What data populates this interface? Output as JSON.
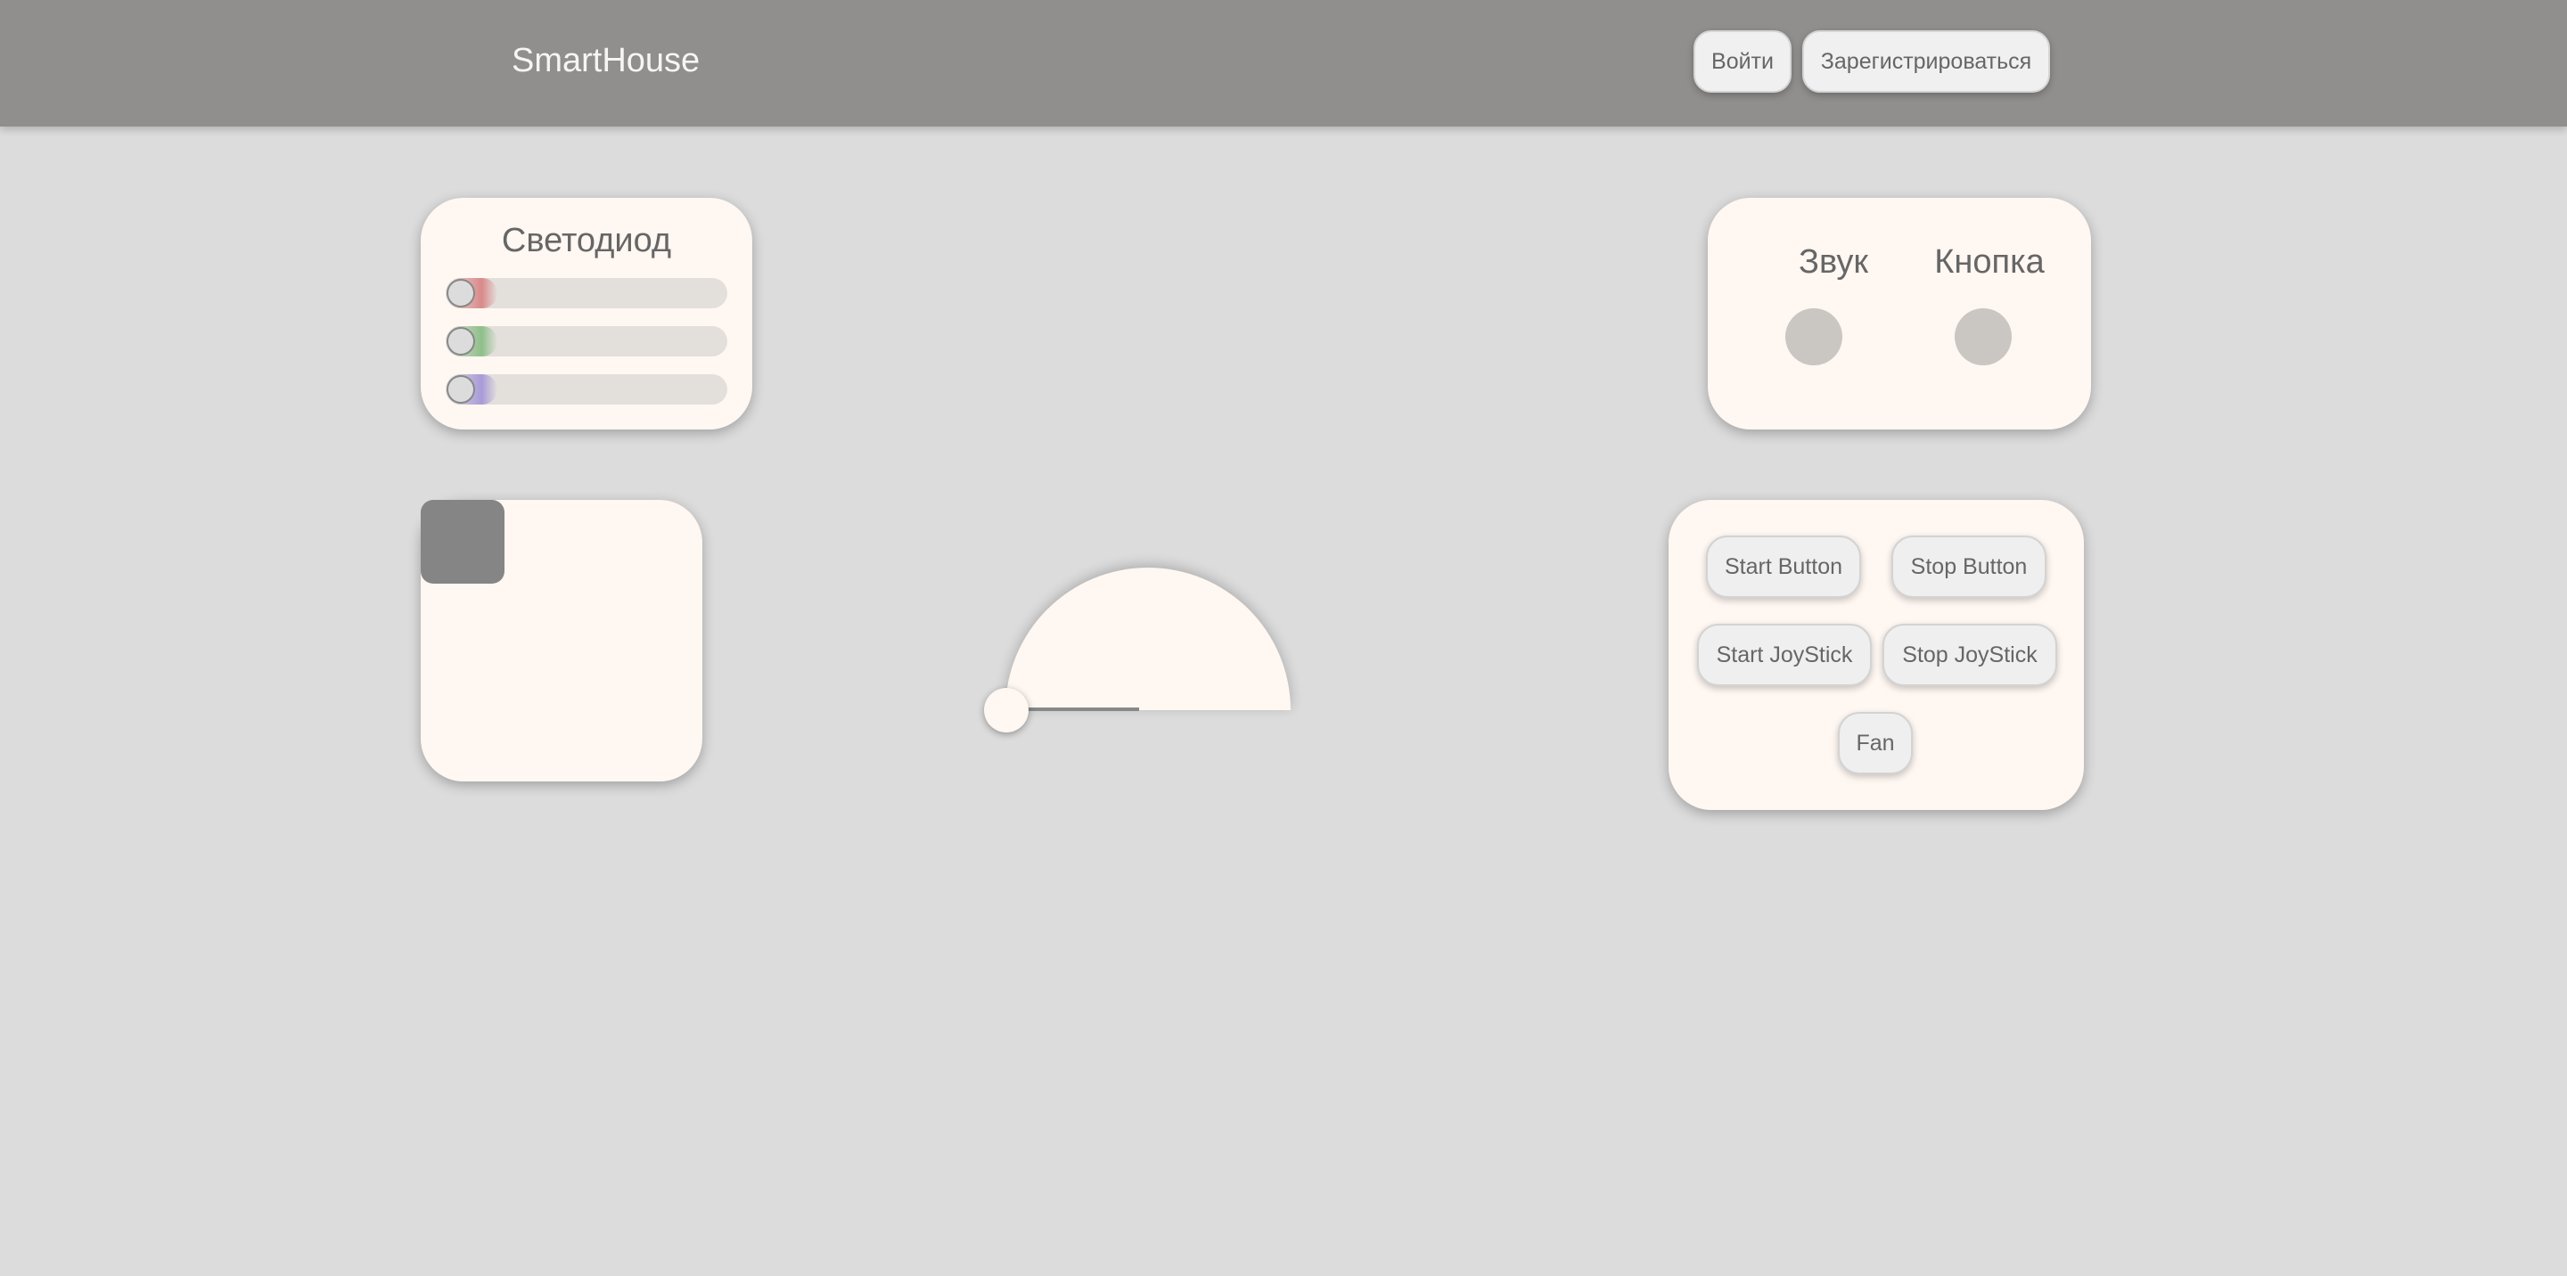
{
  "header": {
    "brand": "SmartHouse",
    "login_label": "Войти",
    "register_label": "Зарегистрироваться"
  },
  "led_card": {
    "title": "Светодиод",
    "sliders": [
      {
        "channel": "red",
        "tint": "#d98a8a",
        "level": 0
      },
      {
        "channel": "green",
        "tint": "#8fbf8a",
        "level": 0
      },
      {
        "channel": "blue",
        "tint": "#a89ad8",
        "level": 0
      }
    ]
  },
  "indicators_card": {
    "sound_label": "Звук",
    "button_label": "Кнопка"
  },
  "joystick": {
    "handle_color": "#858585"
  },
  "gauge": {
    "level": 0
  },
  "commands_card": {
    "start_button": "Start Button",
    "stop_button": "Stop Button",
    "start_joystick": "Start JoyStick",
    "stop_joystick": "Stop JoyStick",
    "fan": "Fan"
  },
  "colors": {
    "page_bg": "#dcdcdc",
    "header_bg": "#908f8d",
    "card_bg": "#fff7f2",
    "indicator_off": "#cac6c2"
  }
}
